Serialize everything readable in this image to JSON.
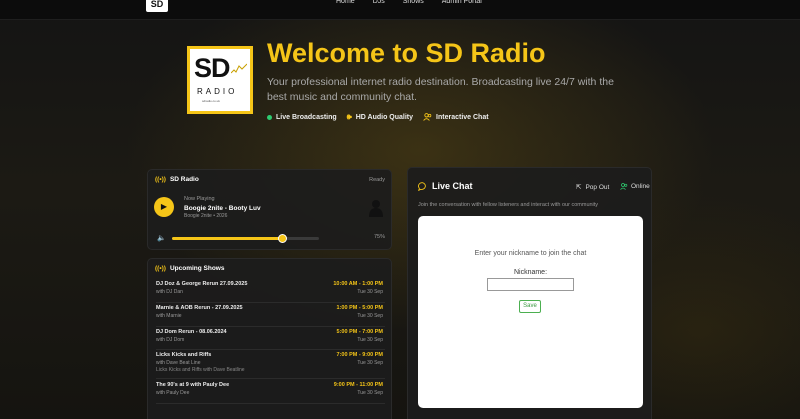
{
  "nav": {
    "logo_text": "SD",
    "links": [
      "Home",
      "DJs",
      "Shows",
      "Admin Portal"
    ]
  },
  "hero": {
    "logo": {
      "big": "SD",
      "word": "RADIO",
      "url": "sdradio.co.uk"
    },
    "title": "Welcome to SD Radio",
    "subtitle": "Your professional internet radio destination. Broadcasting live 24/7 with the best music and community chat.",
    "features": [
      "Live Broadcasting",
      "HD Audio Quality",
      "Interactive Chat"
    ]
  },
  "player": {
    "title": "SD Radio",
    "status": "Ready",
    "now_label": "Now Playing",
    "track": "Boogie 2nite - Booty Luv",
    "meta": "Boogie 2nite • 2026",
    "volume_percent": 75,
    "volume_label": "75%"
  },
  "shows": {
    "title": "Upcoming Shows",
    "items": [
      {
        "name": "DJ Doz & George Rerun 27.09.2025",
        "host": "with DJ Dan",
        "extra": "",
        "time": "10:00 AM - 1:00 PM",
        "date": "Tue 30 Sep"
      },
      {
        "name": "Marnie & AOB Rerun - 27.09.2025",
        "host": "with Marnie",
        "extra": "",
        "time": "1:00 PM - 5:00 PM",
        "date": "Tue 30 Sep"
      },
      {
        "name": "DJ Dom Rerun - 08.06.2024",
        "host": "with DJ Dom",
        "extra": "",
        "time": "5:00 PM - 7:00 PM",
        "date": "Tue 30 Sep"
      },
      {
        "name": "Licks Kicks and Riffs",
        "host": "with Dave Beat Line",
        "extra": "Licks Kicks and Riffs with Dave Beatline",
        "time": "7:00 PM - 9:00 PM",
        "date": "Tue 30 Sep"
      },
      {
        "name": "The 90's at 9 with Pauly Dee",
        "host": "with Pauly Dee",
        "extra": "",
        "time": "9:00 PM - 11:00 PM",
        "date": "Tue 30 Sep"
      }
    ]
  },
  "chat": {
    "title": "Live Chat",
    "popout": "Pop Out",
    "online": "Online",
    "subtitle": "Join the conversation with fellow listeners and interact with our community",
    "prompt": "Enter your nickname to join the chat",
    "nick_label": "Nickname:",
    "nick_value": "",
    "save": "Save"
  },
  "colors": {
    "accent": "#f5c518",
    "online": "#2ecc71",
    "save": "#4caf50"
  }
}
